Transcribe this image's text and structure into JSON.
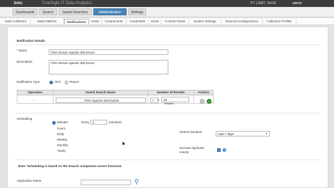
{
  "app": {
    "brand": "bmc",
    "title": "TrueSight IT Data Analytics",
    "top_right": "PT | GMT -04:00",
    "user": "admin"
  },
  "nav": {
    "tabs": [
      "Dashboards",
      "Search",
      "Saved Searches",
      "Administration",
      "Settings"
    ],
    "active": "Administration"
  },
  "subnav": {
    "tabs": [
      "Data Collectors",
      "Data Patterns",
      "Notifications",
      "Hosts",
      "Components",
      "Credentials",
      "Hosts",
      "Content Packs",
      "System Settings",
      "External Configurations",
      "Collection Profiles"
    ],
    "active": "Notifications"
  },
  "details": {
    "section_title": "Notification Details",
    "name_label": "* Name",
    "name_value": "ITDA Server Apache 200 Errors",
    "description_label": "Description",
    "description_value": "ITDA Server Apache 200 Errors",
    "type_label": "Notification Type",
    "type_options": [
      "Alert",
      "Report"
    ],
    "type_selected": "Alert"
  },
  "table": {
    "headers": [
      "Operation",
      "Saved Search Name",
      "Number of Results",
      "Actions"
    ],
    "row": {
      "operation": "--",
      "saved_search": "ITDA Apache 200 Events",
      "operator": ">",
      "count": "20",
      "count_unit": "Results"
    }
  },
  "scheduling": {
    "label": "Scheduling",
    "options": [
      "Minutes",
      "Hours",
      "Daily",
      "Weekly",
      "Monthly",
      "Yearly"
    ],
    "selected": "Minutes",
    "every_label": "Every",
    "every_value": "1",
    "every_unit": "minute(s)",
    "search_duration_label": "Search Duration",
    "search_duration_value": "Last 7 days",
    "exclude_label_1": "Exclude duplicate",
    "exclude_label_2": "events",
    "exclude_checked": true,
    "note": "Note: Scheduling is based on the Search component server timezone."
  },
  "app_name": {
    "label": "Application Name",
    "value": ""
  },
  "colors": {
    "accent": "#4b85b8",
    "action_green": "#3aa43a",
    "topbar": "#3c3c3c"
  },
  "icons": {
    "add_action": "plus-icon",
    "remove_action": "minus-icon",
    "info": "info-icon",
    "search": "search-icon"
  }
}
